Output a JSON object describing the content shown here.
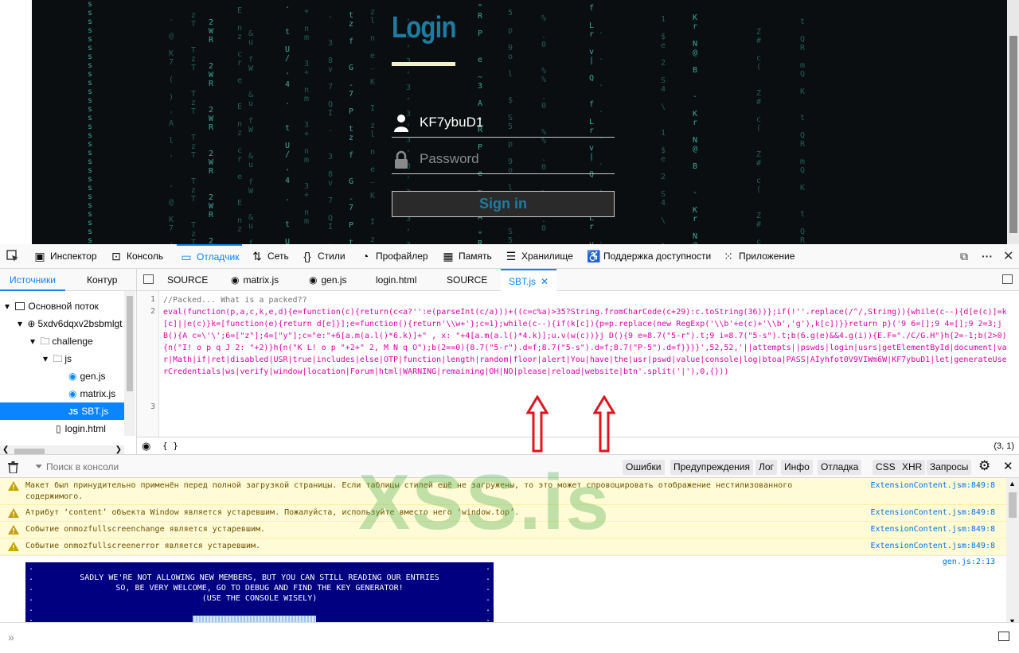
{
  "page": {
    "login_title": "Login",
    "username_value": "KF7ybuD1",
    "password_placeholder": "Password",
    "signin_label": "Sign in",
    "matrix_columns": [
      "s",
      "7\nA\n.\n(\nl\n@\n)\n'\nK\n'",
      "T\nz\nT",
      "R\nW\n2",
      "r\nz\nE\ne\nc\nn",
      "u\nW\n&\nf",
      "4\n/\nt\n.\n'\nU",
      "+\nm\n3\nn",
      "v\nI\n3\n7\n-\n8\nQ",
      "7\nz\nG\nP\nf\n-\nt",
      "l\n_\nI\nn\nK\nz\ne",
      "@\n,\n8\nv\n3",
      "3\nR\ne\nA\nP\n~\n\"",
      "5\no\n$\np\nl\nS\n9",
      "%\n0\n%\n.",
      "|\nr\nf\nQ\nv\nL",
      "t\n@\n.\n0\n%",
      "e\n4\n1\n2\n\\\n$\nS",
      "@\nr\n-\nB\nN\nK",
      "#\n(\nZ\nc",
      "Q\nR\nt\nK\nm\nQ"
    ]
  },
  "devtools": {
    "toolbar_tabs": [
      {
        "label": "Инспектор",
        "icon": "inspector-icon"
      },
      {
        "label": "Консоль",
        "icon": "console-icon"
      },
      {
        "label": "Отладчик",
        "icon": "debugger-icon"
      },
      {
        "label": "Сеть",
        "icon": "network-icon"
      },
      {
        "label": "Стили",
        "icon": "style-icon"
      },
      {
        "label": "Профайлер",
        "icon": "profiler-icon"
      },
      {
        "label": "Память",
        "icon": "memory-icon"
      },
      {
        "label": "Хранилище",
        "icon": "storage-icon"
      },
      {
        "label": "Поддержка доступности",
        "icon": "accessibility-icon"
      },
      {
        "label": "Приложение",
        "icon": "application-icon"
      }
    ],
    "sources_tabs": [
      "Источники",
      "Контур"
    ],
    "tree": [
      {
        "label": "Основной поток",
        "depth": 0
      },
      {
        "label": "5xdv6dqxv2bsbmlgt",
        "depth": 1
      },
      {
        "label": "challenge",
        "depth": 2
      },
      {
        "label": "js",
        "depth": 3
      },
      {
        "label": "gen.js",
        "depth": 4
      },
      {
        "label": "matrix.js",
        "depth": 4
      },
      {
        "label": "SBT.js",
        "depth": 4,
        "selected": true
      },
      {
        "label": "login.html",
        "depth": 3
      }
    ],
    "editor_tabs": [
      "SOURCE",
      "matrix.js",
      "gen.js",
      "login.html",
      "SOURCE",
      "SBT.js"
    ],
    "line_numbers": [
      "1",
      "2",
      "3"
    ],
    "code_line1": "//Packed... What is a packed??",
    "code_line2_a": "eval(function(p,a,c,k,e,d){e=function(c){return(c<a?'':e(parseInt(c/a)))+((c=c%a)>35?String.fromCharCode(c+29):c.toString(36))};if(!''.replace(/^/,String)){while(c--){d[e(c)]=k[c]||e(c)}k=[function(e){return d[e]}];e=function(){return'\\\\w+'};c=1};while(c--){if(k[c]){p=p.replace(new RegExp('\\\\b'+e(c)+'\\\\b','g'),k[c])}}return p}('9 6=[];9 4=[];9 2=3;j B(){A c=\\'\\';6=[\"z\"];4=[\"y\"];c=\"e:\"+6[a.m(a.l()*6.k)]+\" , x: \"+4[a.m(a.l()*4.k)];u.v(w(c))}j D(){9 e=8.7(\"5-r\").t;9 i=8.7(\"5-s\").t;b(6.g(e)&&4.g(i)){E.F=\"./C/G.H\"}h{2=-1;b(2>0){n(\"I! o p q J 2: \"+2)}h{n(\"K L! o p \"+2+\" 2, M N q O\");b(2==0){8.7(\"5-r\").d=f;8.7(\"5-s\").d=f;8.7(\"P-5\").d=f}}}}',52,52,'||attempts||pswds|login|usrs|getElementById|document|var|Math|if|ret|disabled|USR|true|includes|else|OTP|function|length|random|floor|alert|You|have|the|usr|pswd|value|console|log|btoa|PASS|AIyhfot0V9VIWm6W|KF7ybuD1|let|generateUserCredentials|ws|verify|window|location|Forum|html|WARNING|remaining|OH|NO|please|reload|website|btn'.split('|'),0,{}))",
    "footer_braces": "{ }",
    "cursor_pos": "(3, 1)",
    "watermark": "XSS.is",
    "console_filter_placeholder": "Поиск в консоли",
    "console_filters": [
      "Ошибки",
      "Предупреждения",
      "Лог",
      "Инфо",
      "Отладка",
      "CSS",
      "XHR",
      "Запросы"
    ],
    "messages": [
      {
        "text": "Макет был принудительно применён перед полной загрузкой страницы. Если таблицы стилей ещё не загружены, то это может спровоцировать отображение нестилизованного содержимого.",
        "loc": "ExtensionContent.jsm:849:8"
      },
      {
        "text": "Атрибут ‘content’ объекта Window является устаревшим.  Пожалуйста, используйте вместо него ‘window.top’.",
        "loc": "ExtensionContent.jsm:849:8"
      },
      {
        "text": "Событие onmozfullscreenchange является устаревшим.",
        "loc": "ExtensionContent.jsm:849:8"
      },
      {
        "text": "Событие onmozfullscreenerror является устаревшим.",
        "loc": "ExtensionContent.jsm:849:8"
      }
    ],
    "log_loc": "gen.js:2:13",
    "banner_lines": [
      "",
      "SADLY WE'RE NOT ALLOWING NEW MEMBERS, BUT YOU CAN STILL READING OUR ENTRIES",
      "SO, BE VERY WELCOME, GO TO DEBUG AND FIND THE KEY GENERATOR!",
      "(USE THE CONSOLE WISELY)",
      "",
      ""
    ],
    "colors": {
      "accent": "#0a84ff",
      "login_blue": "#1d7ca2",
      "banner_bg": "#000080",
      "warning_bg": "#fffbd6",
      "arrow_red": "#e0141e"
    }
  }
}
